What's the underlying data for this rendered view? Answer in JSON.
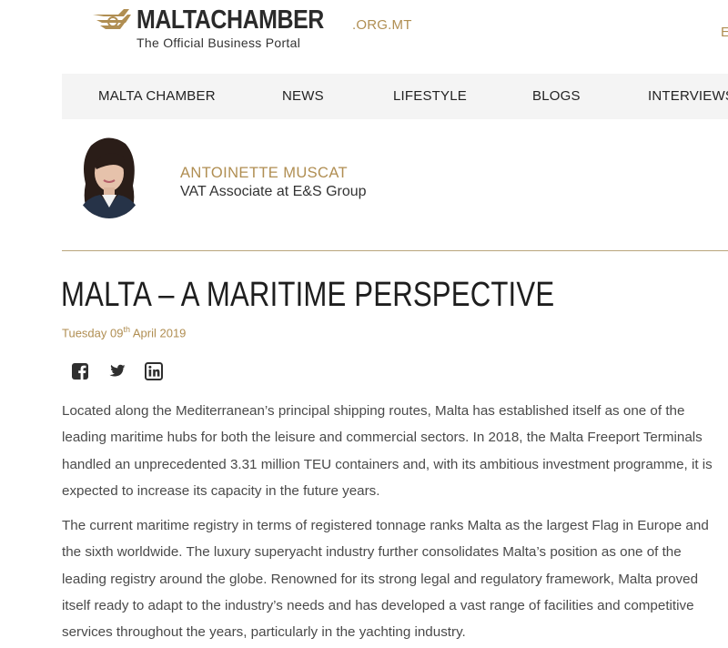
{
  "brand": {
    "name": "MALTACHAMBER",
    "suffix": ".ORG.MT",
    "tagline": "The Official Business Portal",
    "accent_color": "#b08e52"
  },
  "header": {
    "right_text": "E"
  },
  "nav": {
    "items": [
      {
        "label": "MALTA CHAMBER"
      },
      {
        "label": "NEWS"
      },
      {
        "label": "LIFESTYLE"
      },
      {
        "label": "BLOGS"
      },
      {
        "label": "INTERVIEWS"
      }
    ]
  },
  "author": {
    "name": "ANTOINETTE MUSCAT",
    "role": "VAT Associate at E&S Group"
  },
  "article": {
    "title": "MALTA – A MARITIME PERSPECTIVE",
    "date": {
      "weekday_day": "Tuesday 09",
      "ordinal": "th",
      "month_year": " April 2019"
    },
    "social": [
      {
        "icon": "facebook-icon"
      },
      {
        "icon": "twitter-icon"
      },
      {
        "icon": "linkedin-icon"
      }
    ],
    "paragraph_1": {
      "lines": [
        "Located along the Mediterranean’s principal shipping routes, Malta has established itself as one of the",
        "leading maritime hubs for both the leisure and commercial sectors. In 2018, the Malta Freeport Terminals",
        "handled an unprecedented 3.31 million TEU containers and, with its ambitious investment programme, it is",
        "expected to increase its capacity in the future years."
      ]
    },
    "paragraph_2": {
      "lines": [
        "The current maritime registry in terms of registered tonnage ranks Malta as the largest Flag in Europe and",
        "the sixth worldwide. The luxury superyacht industry further consolidates Malta’s position as one of the",
        "leading registry around the globe. Renowned for its strong legal and regulatory framework, Malta proved",
        "itself ready to adapt to the industry’s needs and has developed a vast range of facilities and competitive",
        "services throughout the years, particularly in the yachting industry."
      ]
    }
  }
}
